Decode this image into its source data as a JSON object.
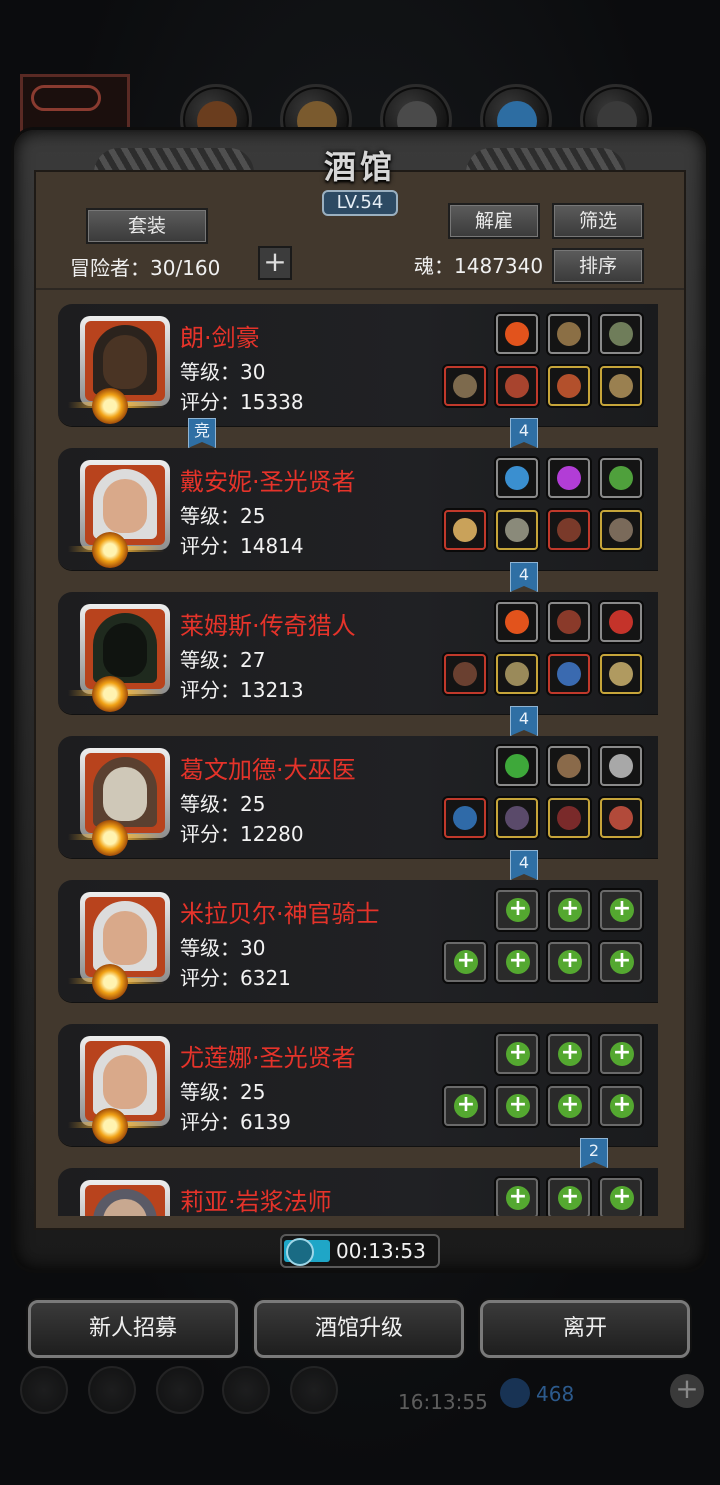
{
  "header": {
    "title": "酒馆",
    "level": "LV.54"
  },
  "toolbar": {
    "suit_label": "套装",
    "dismiss_label": "解雇",
    "filter_label": "筛选",
    "sort_label": "排序",
    "adventurers_label": "冒险者：30/160",
    "soul_label": "魂：1487340"
  },
  "heroes": [
    {
      "name": "朗·剑豪",
      "level": "等级：30",
      "score": "评分：15338",
      "flag": "竞",
      "badge": "4"
    },
    {
      "name": "戴安妮·圣光贤者",
      "level": "等级：25",
      "score": "评分：14814",
      "badge": "4"
    },
    {
      "name": "莱姆斯·传奇猎人",
      "level": "等级：27",
      "score": "评分：13213",
      "badge": "4"
    },
    {
      "name": "葛文加德·大巫医",
      "level": "等级：25",
      "score": "评分：12280",
      "badge": "4"
    },
    {
      "name": "米拉贝尔·神官骑士",
      "level": "等级：30",
      "score": "评分：6321"
    },
    {
      "name": "尤莲娜·圣光贤者",
      "level": "等级：25",
      "score": "评分：6139",
      "badge": "2"
    },
    {
      "name": "莉亚·岩浆法师"
    }
  ],
  "timer": {
    "value": "00:13:53",
    "progress": 0.3
  },
  "actions": {
    "recruit": "新人招募",
    "upgrade": "酒馆升级",
    "leave": "离开"
  },
  "dock": {
    "time": "16:13:55",
    "gems": "468"
  },
  "colors": {
    "name_red": "#e5332a",
    "badge_blue": "#2f6fa4",
    "empty_plus_green": "#54a830"
  }
}
